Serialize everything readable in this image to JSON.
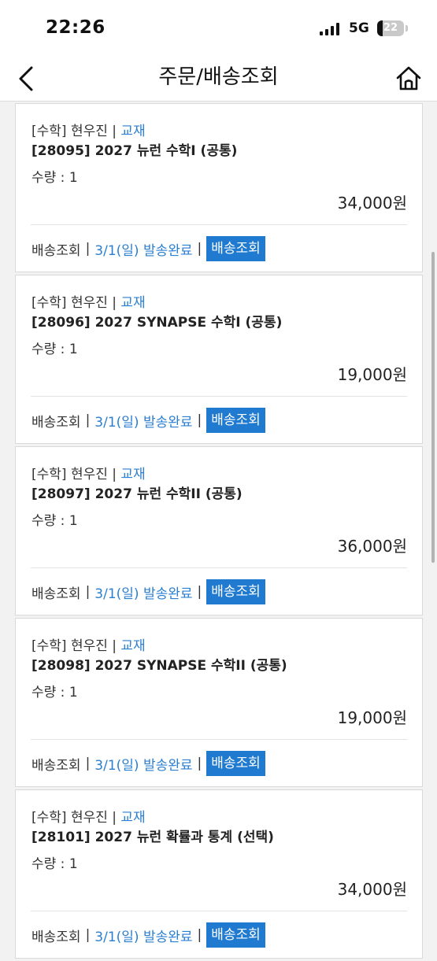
{
  "status_bar": {
    "time": "22:26",
    "network": "5G",
    "battery_level": "22",
    "icons": [
      "signal-icon",
      "battery-icon"
    ]
  },
  "nav": {
    "title": "주문/배송조회",
    "icons": [
      "chevron-left-icon",
      "home-icon"
    ]
  },
  "orders": [
    {
      "subject": "[수학]",
      "teacher": "현우진",
      "separator": "|",
      "type": "교재",
      "title": "[28095] 2027 뉴런 수학I (공통)",
      "quantity": "수량 : 1",
      "price": "34,000원",
      "ship_label": "배송조회",
      "ship_status": "3/1(일) 발송완료",
      "ship_button": "배송조회"
    },
    {
      "subject": "[수학]",
      "teacher": "현우진",
      "separator": "|",
      "type": "교재",
      "title": "[28096] 2027 SYNAPSE 수학I (공통)",
      "quantity": "수량 : 1",
      "price": "19,000원",
      "ship_label": "배송조회",
      "ship_status": "3/1(일) 발송완료",
      "ship_button": "배송조회"
    },
    {
      "subject": "[수학]",
      "teacher": "현우진",
      "separator": "|",
      "type": "교재",
      "title": "[28097] 2027 뉴런 수학II (공통)",
      "quantity": "수량 : 1",
      "price": "36,000원",
      "ship_label": "배송조회",
      "ship_status": "3/1(일) 발송완료",
      "ship_button": "배송조회"
    },
    {
      "subject": "[수학]",
      "teacher": "현우진",
      "separator": "|",
      "type": "교재",
      "title": "[28098] 2027 SYNAPSE 수학II (공통)",
      "quantity": "수량 : 1",
      "price": "19,000원",
      "ship_label": "배송조회",
      "ship_status": "3/1(일) 발송완료",
      "ship_button": "배송조회"
    },
    {
      "subject": "[수학]",
      "teacher": "현우진",
      "separator": "|",
      "type": "교재",
      "title": "[28101] 2027 뉴런 확률과 통계 (선택)",
      "quantity": "수량 : 1",
      "price": "34,000원",
      "ship_label": "배송조회",
      "ship_status": "3/1(일) 발송완료",
      "ship_button": "배송조회"
    }
  ],
  "colors": {
    "accent": "#1f7ad0",
    "link": "#2b7fd1",
    "background": "#f2f2f2",
    "card": "#ffffff"
  }
}
